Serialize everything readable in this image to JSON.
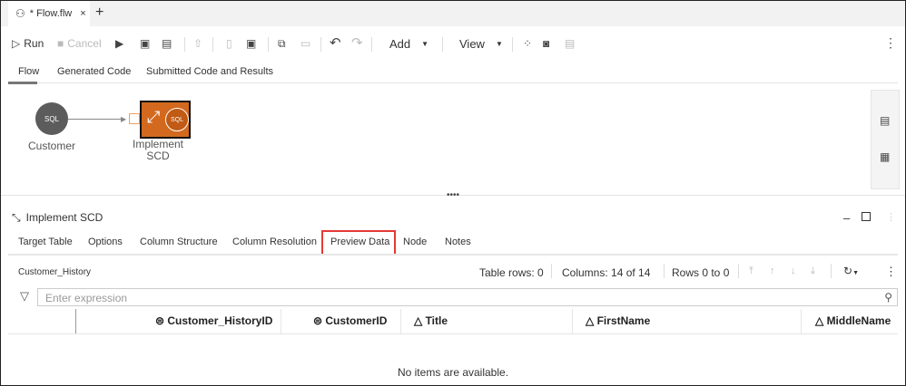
{
  "file_tab": {
    "title": "* Flow.flw",
    "close": "×",
    "new": "+"
  },
  "toolbar": {
    "run": "Run",
    "cancel": "Cancel",
    "add": "Add",
    "view": "View"
  },
  "subtabs": [
    "Flow",
    "Generated Code",
    "Submitted Code and Results"
  ],
  "nodes": [
    {
      "label": "Customer",
      "badge": "SQL"
    },
    {
      "label_line1": "Implement",
      "label_line2": "SCD",
      "badge": "SQL"
    }
  ],
  "panel": {
    "title": "Implement SCD",
    "tabs": [
      "Target Table",
      "Options",
      "Column Structure",
      "Column Resolution",
      "Preview Data",
      "Node",
      "Notes"
    ],
    "table_name": "Customer_History",
    "table_rows": "Table rows: 0",
    "columns": "Columns: 14 of 14",
    "rows_range": "Rows 0 to 0",
    "filter_placeholder": "Enter expression",
    "headers": [
      "Customer_HistoryID",
      "CustomerID",
      "Title",
      "FirstName",
      "MiddleName"
    ],
    "empty": "No items are available."
  },
  "colors": {
    "accent": "#d2691e",
    "highlight": "#e53935"
  }
}
